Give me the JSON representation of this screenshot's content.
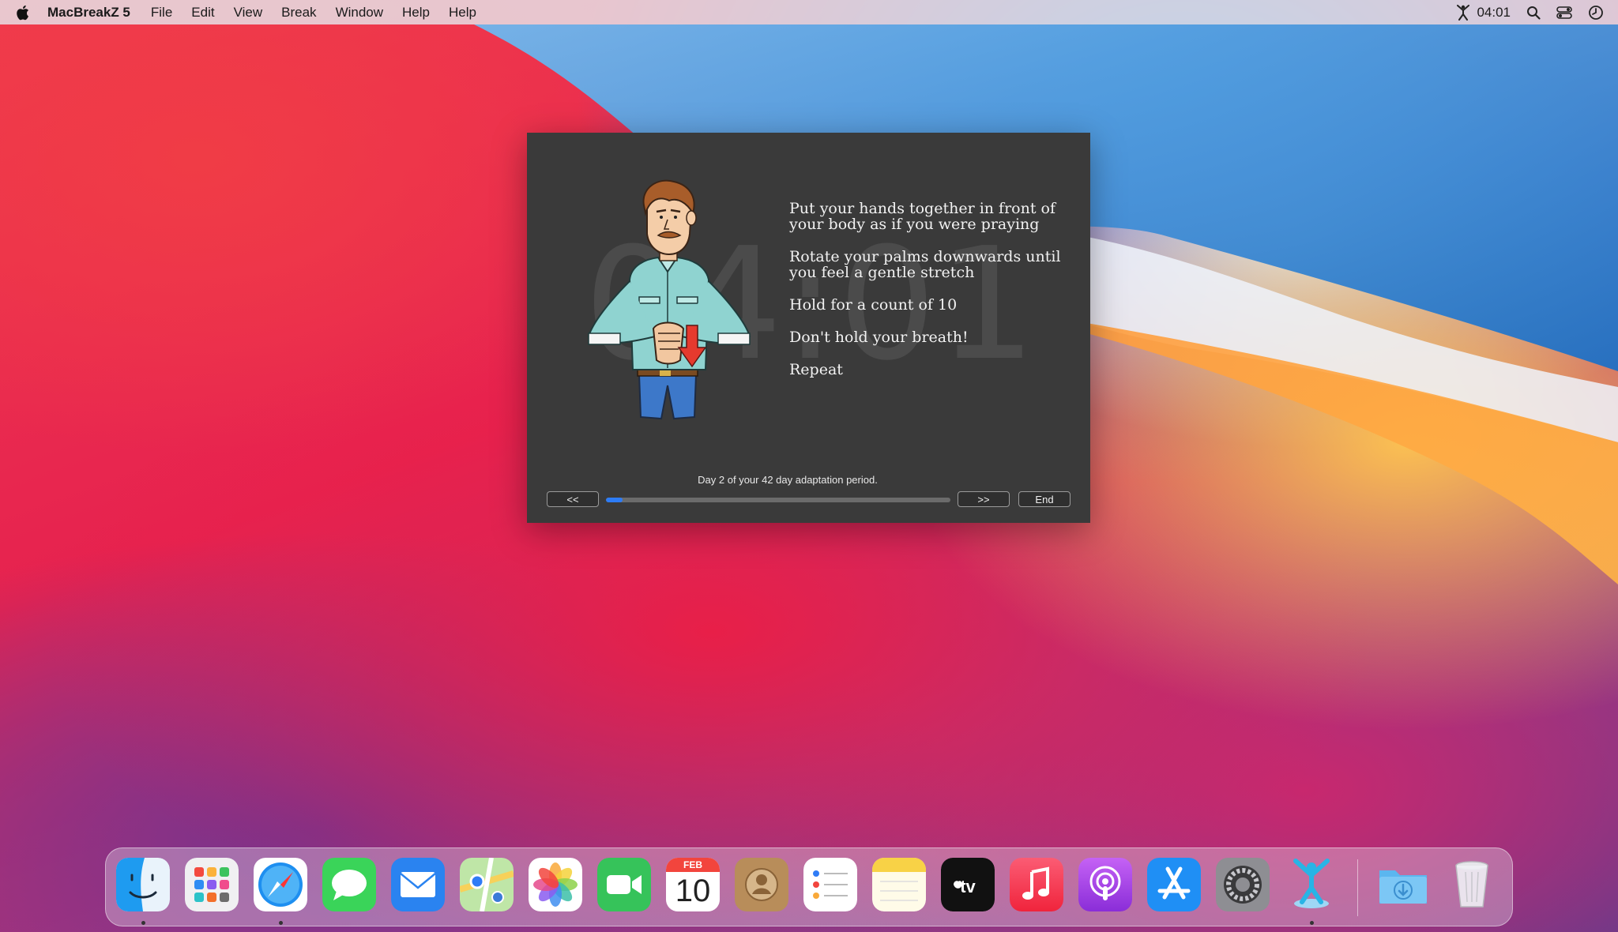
{
  "menubar": {
    "app_name": "MacBreakZ 5",
    "items": [
      "File",
      "Edit",
      "View",
      "Break",
      "Window",
      "Help",
      "Help"
    ],
    "clock": "04:01"
  },
  "break_window": {
    "timer": "04:01",
    "instructions": [
      "Put your hands together in front of your body as if you were praying",
      "Rotate your palms downwards until you feel a gentle stretch",
      "Hold for a count of 10",
      "Don't hold your breath!",
      "Repeat"
    ],
    "adaptation_text": "Day 2 of your 42 day adaptation period.",
    "prev_label": "<<",
    "next_label": ">>",
    "end_label": "End",
    "progress_fraction": 0.048,
    "progress_color": "#2d7cf6"
  },
  "dock": {
    "calendar_month": "FEB",
    "calendar_day": "10",
    "apps": [
      "finder-icon",
      "launchpad-icon",
      "safari-icon",
      "messages-icon",
      "mail-icon",
      "maps-icon",
      "photos-icon",
      "facetime-icon",
      "calendar-icon",
      "contacts-icon",
      "reminders-icon",
      "notes-icon",
      "apple-tv-icon",
      "music-icon",
      "podcasts-icon",
      "app-store-icon",
      "system-preferences-icon",
      "macbreakz-icon",
      "downloads-folder-icon",
      "trash-icon"
    ]
  }
}
